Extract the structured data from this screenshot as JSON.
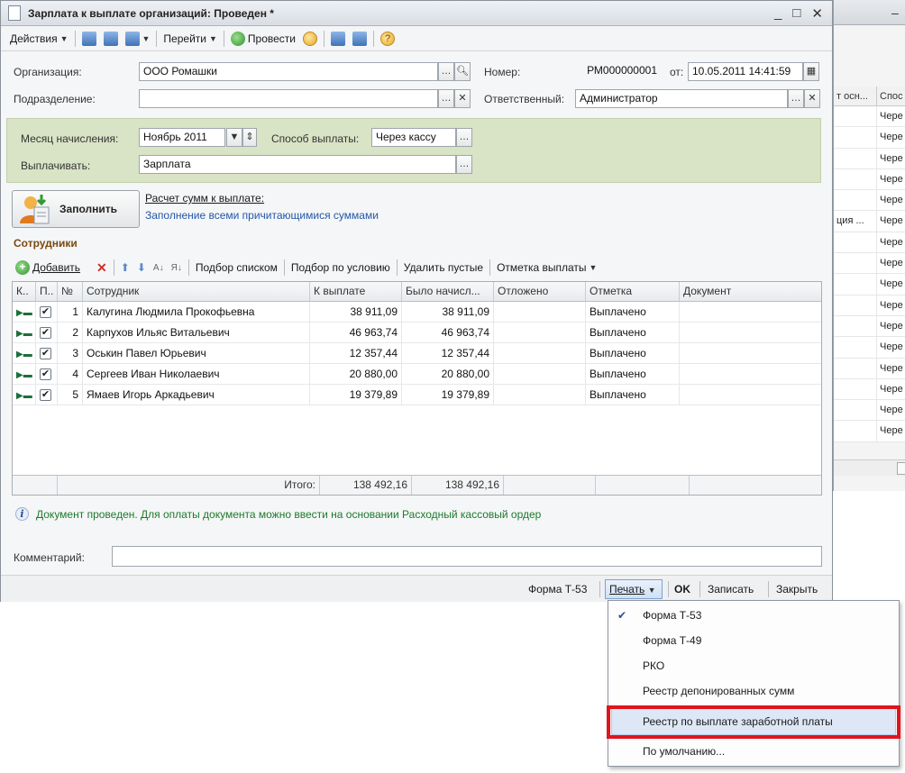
{
  "window": {
    "title": "Зарплата к выплате организаций: Проведен *",
    "controls": [
      "_",
      "□",
      "✕"
    ]
  },
  "toolbar": {
    "actions": "Действия",
    "goto": "Перейти",
    "post": "Провести"
  },
  "form": {
    "org_label": "Организация:",
    "org_value": "ООО Ромашки",
    "number_label": "Номер:",
    "number_value": "РМ000000001",
    "from_label": "от:",
    "date_value": "10.05.2011 14:41:59",
    "dept_label": "Подразделение:",
    "dept_value": "",
    "resp_label": "Ответственный:",
    "resp_value": "Администратор",
    "month_label": "Месяц начисления:",
    "month_value": "Ноябрь 2011",
    "paymethod_label": "Способ выплаты:",
    "paymethod_value": "Через кассу",
    "payout_label": "Выплачивать:",
    "payout_value": "Зарплата"
  },
  "fill": {
    "button_label": "Заполнить",
    "link1": "Расчет сумм к выплате:",
    "link2": "Заполнение всеми причитающимися суммами"
  },
  "employees": {
    "section_title": "Сотрудники",
    "toolbar": {
      "add": "Добавить",
      "pick_list": "Подбор списком",
      "pick_cond": "Подбор по условию",
      "delete_empty": "Удалить пустые",
      "mark_payment": "Отметка выплаты"
    },
    "columns": {
      "k": "К..",
      "p": "П..",
      "n": "№",
      "employee": "Сотрудник",
      "to_pay": "К выплате",
      "accrued": "Было начисл...",
      "deferred": "Отложено",
      "mark": "Отметка",
      "doc": "Документ"
    },
    "rows": [
      {
        "n": "1",
        "name": "Калугина Людмила Прокофьевна",
        "to_pay": "38 911,09",
        "accrued": "38 911,09",
        "mark": "Выплачено"
      },
      {
        "n": "2",
        "name": "Карпухов Ильяс Витальевич",
        "to_pay": "46 963,74",
        "accrued": "46 963,74",
        "mark": "Выплачено"
      },
      {
        "n": "3",
        "name": "Оськин Павел Юрьевич",
        "to_pay": "12 357,44",
        "accrued": "12 357,44",
        "mark": "Выплачено"
      },
      {
        "n": "4",
        "name": "Сергеев Иван Николаевич",
        "to_pay": "20 880,00",
        "accrued": "20 880,00",
        "mark": "Выплачено"
      },
      {
        "n": "5",
        "name": "Ямаев Игорь Аркадьевич",
        "to_pay": "19 379,89",
        "accrued": "19 379,89",
        "mark": "Выплачено"
      }
    ],
    "total_label": "Итого:",
    "total_to_pay": "138 492,16",
    "total_accrued": "138 492,16"
  },
  "info_text": "Документ проведен. Для оплаты документа можно ввести на основании Расходный кассовый ордер",
  "comment_label": "Комментарий:",
  "comment_value": "",
  "bottom": {
    "form_t53": "Форма Т-53",
    "print": "Печать",
    "ok": "OK",
    "save": "Записать",
    "close": "Закрыть"
  },
  "print_menu": {
    "items": [
      "Форма Т-53",
      "Форма Т-49",
      "РКО",
      "Реестр депонированных сумм",
      "Реестр по выплате заработной платы",
      "По умолчанию..."
    ]
  },
  "bg_window": {
    "col1": "т осн...",
    "col2": "Спос",
    "cells1": [
      "",
      "",
      "",
      "",
      "",
      "ция ...",
      "",
      "",
      "",
      "",
      "",
      "",
      "",
      "",
      "",
      ""
    ],
    "cells2": [
      "Чере",
      "Чере",
      "Чере",
      "Чере",
      "Чере",
      "Чере",
      "Чере",
      "Чере",
      "Чере",
      "Чере",
      "Чере",
      "Чере",
      "Чере",
      "Чере",
      "Чере",
      "Чере"
    ]
  },
  "colors": {
    "green_panel": "#d9e3c5",
    "section_title": "#7a4a12",
    "link": "#2357a8",
    "info_text": "#1c7a2a",
    "highlight_border": "#e0141e"
  },
  "icons": [
    "doc-icon",
    "minimize-icon",
    "maximize-icon",
    "close-icon",
    "search-icon",
    "clear-icon",
    "ellipsis-icon",
    "calendar-icon",
    "add-icon",
    "delete-icon",
    "arrow-up-icon",
    "arrow-down-icon",
    "sort-asc-icon",
    "sort-desc-icon",
    "info-icon",
    "check-icon",
    "help-icon",
    "user-fill-icon"
  ]
}
